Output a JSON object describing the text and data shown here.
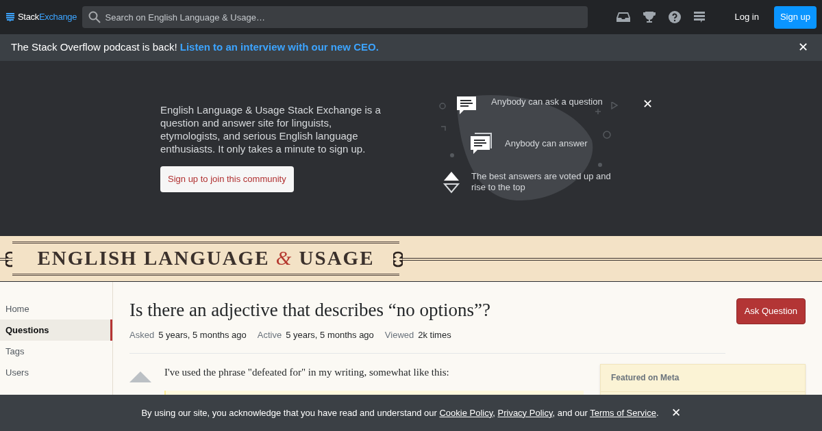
{
  "topbar": {
    "logo": {
      "part_1": "Stack",
      "part_2": "Exchange"
    },
    "search": {
      "placeholder": "Search on English Language & Usage…"
    },
    "login": "Log in",
    "signup": "Sign up"
  },
  "announcement": {
    "text": "The Stack Overflow podcast is back!",
    "link": "Listen to an interview with our new CEO.",
    "close": "✕"
  },
  "hero": {
    "description": "English Language & Usage Stack Exchange is a question and answer site for linguists, etymologists, and serious English language enthusiasts. It only takes a minute to sign up.",
    "join_button": "Sign up to join this community",
    "close": "✕",
    "features": [
      {
        "kind": "ask",
        "text": "Anybody can ask a question"
      },
      {
        "kind": "answer",
        "text": "Anybody can answer"
      },
      {
        "kind": "vote",
        "text": "The best answers are voted up and rise to the top"
      }
    ]
  },
  "site_header": {
    "title_parts": [
      "ENGLISH LANGUAGE",
      "&",
      "USAGE"
    ]
  },
  "sidebar": {
    "items": [
      {
        "label": "Home",
        "selected": false
      },
      {
        "label": "Questions",
        "selected": true
      },
      {
        "label": "Tags",
        "selected": false
      },
      {
        "label": "Users",
        "selected": false
      }
    ]
  },
  "question": {
    "title": "Is there an adjective that describes “no options”?",
    "ask_button": "Ask Question",
    "meta": [
      {
        "label": "Asked",
        "value": "5 years, 5 months ago"
      },
      {
        "label": "Active",
        "value": "5 years, 5 months ago"
      },
      {
        "label": "Viewed",
        "value": "2k times"
      }
    ],
    "body": "I've used the phrase \"defeated for\" in my writing, somewhat like this:"
  },
  "featured_box": {
    "title": "Featured on Meta"
  },
  "cookie_bar": {
    "segments": [
      {
        "kind": "text",
        "text": "By using our site, you acknowledge that you have read and understand our "
      },
      {
        "kind": "link",
        "text": "Cookie Policy"
      },
      {
        "kind": "text",
        "text": ", "
      },
      {
        "kind": "link",
        "text": "Privacy Policy"
      },
      {
        "kind": "text",
        "text": ", and our "
      },
      {
        "kind": "link",
        "text": "Terms of Service"
      },
      {
        "kind": "text",
        "text": "."
      }
    ],
    "close": "✕"
  }
}
